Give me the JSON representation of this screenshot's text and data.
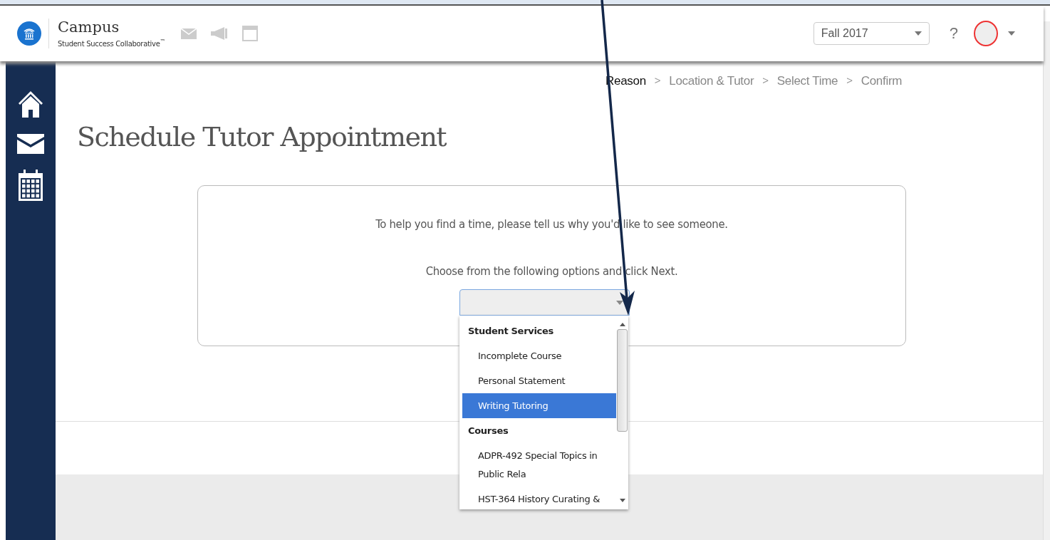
{
  "header": {
    "app_name": "Campus",
    "app_subtitle": "Student Success Collaborative",
    "trademark": "™",
    "term_select": {
      "value": "Fall 2017"
    },
    "help": "?"
  },
  "steps": [
    {
      "label": "Reason",
      "current": true
    },
    {
      "label": "Location & Tutor",
      "current": false
    },
    {
      "label": "Select Time",
      "current": false
    },
    {
      "label": "Confirm",
      "current": false
    }
  ],
  "separator": ">",
  "page_title": "Schedule Tutor Appointment",
  "card": {
    "intro": "To help you find a time, please tell us why you'd like to see someone.",
    "instruction": "Choose from the following options and click Next."
  },
  "dropdown_options": [
    {
      "kind": "group",
      "label": "Student Services",
      "selected": false
    },
    {
      "kind": "option",
      "label": "Incomplete Course",
      "selected": false
    },
    {
      "kind": "option",
      "label": "Personal Statement",
      "selected": false
    },
    {
      "kind": "option",
      "label": "Writing Tutoring",
      "selected": true
    },
    {
      "kind": "group",
      "label": "Courses",
      "selected": false
    },
    {
      "kind": "option",
      "label": "ADPR-492 Special Topics in Public Rela",
      "selected": false
    },
    {
      "kind": "option",
      "label": "HST-364 History Curating &",
      "selected": false
    }
  ]
}
